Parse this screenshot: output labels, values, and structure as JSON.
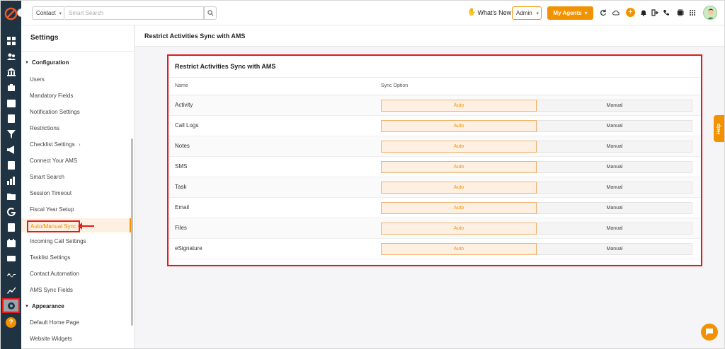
{
  "topbar": {
    "search_type": "Contact",
    "search_placeholder": "Smart Search",
    "whats_new": "What's New",
    "role": "Admin",
    "my_agents": "My Agents"
  },
  "settings": {
    "title": "Settings",
    "sections": [
      {
        "label": "Configuration"
      },
      {
        "label": "Appearance"
      }
    ],
    "items": [
      "Users",
      "Mandatory Fields",
      "Notification Settings",
      "Restrictions",
      "Checklist Settings",
      "Connect Your AMS",
      "Smart Search",
      "Session Timeout",
      "Fiscal Year Setup",
      "Auto/Manual Sync",
      "Incoming Call Settings",
      "Tasklist Settings",
      "Contact Automation",
      "AMS Sync Fields"
    ],
    "appearance_items": [
      "Default Home Page",
      "Website Widgets"
    ],
    "active_item": "Auto/Manual Sync"
  },
  "page": {
    "header_title": "Restrict Activities Sync with AMS",
    "card_title": "Restrict Activities Sync with AMS",
    "columns": [
      "Name",
      "Sync Option"
    ],
    "rows": [
      {
        "name": "Activity",
        "auto": "Auto",
        "manual": "Manual"
      },
      {
        "name": "Call Logs",
        "auto": "Auto",
        "manual": "Manual"
      },
      {
        "name": "Notes",
        "auto": "Auto",
        "manual": "Manual"
      },
      {
        "name": "SMS",
        "auto": "Auto",
        "manual": "Manual"
      },
      {
        "name": "Task",
        "auto": "Auto",
        "manual": "Manual"
      },
      {
        "name": "Email",
        "auto": "Auto",
        "manual": "Manual"
      },
      {
        "name": "Files",
        "auto": "Auto",
        "manual": "Manual"
      },
      {
        "name": "eSignature",
        "auto": "Auto",
        "manual": "Manual"
      }
    ],
    "selected_option": "Auto"
  },
  "help_tab": "Help",
  "colors": {
    "accent": "#f39200",
    "rail": "#1f3342",
    "annotation": "#e31b1b"
  }
}
